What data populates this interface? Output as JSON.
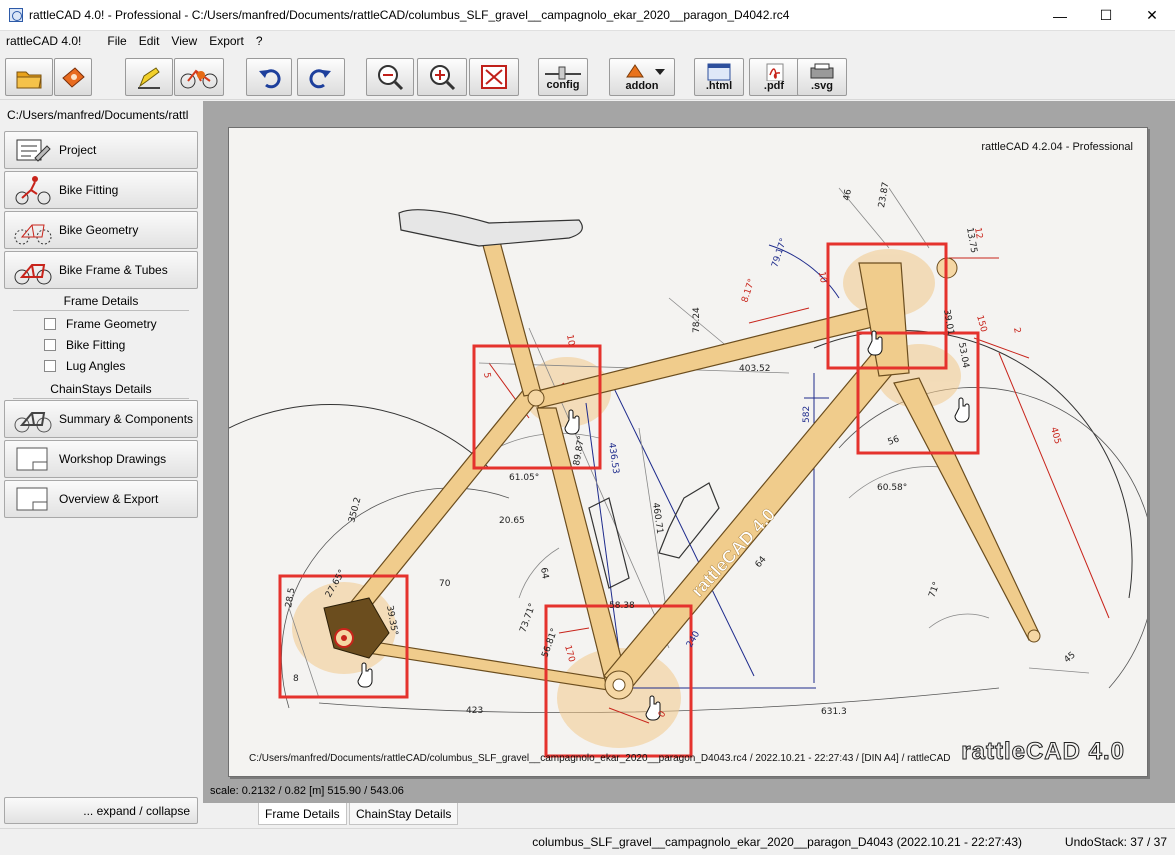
{
  "window": {
    "title": "rattleCAD 4.0! - Professional  - C:/Users/manfred/Documents/rattleCAD/columbus_SLF_gravel__campagnolo_ekar_2020__paragon_D4042.rc4",
    "minimize": "—",
    "maximize": "☐",
    "close": "✕"
  },
  "menu": {
    "app": "rattleCAD 4.0!",
    "items": [
      "File",
      "Edit",
      "View",
      "Export",
      "?"
    ]
  },
  "toolbar": {
    "buttons": [
      {
        "icon": "open-folder-icon"
      },
      {
        "icon": "template-icon"
      },
      {
        "icon": "edit-pen-icon"
      },
      {
        "icon": "bike-render-icon"
      },
      {
        "icon": "undo-icon"
      },
      {
        "icon": "redo-icon"
      },
      {
        "icon": "zoom-out-icon"
      },
      {
        "icon": "zoom-in-icon"
      },
      {
        "icon": "fit-to-window-icon"
      },
      {
        "icon": "config-icon",
        "label": "config"
      },
      {
        "icon": "addon-icon",
        "label": "addon"
      },
      {
        "icon": "html-export-icon",
        "label": ".html"
      },
      {
        "icon": "pdf-export-icon",
        "label": ".pdf"
      },
      {
        "icon": "svg-export-icon",
        "label": ".svg"
      }
    ]
  },
  "sidebar": {
    "path": "C:/Users/manfred/Documents/rattl",
    "nav": [
      {
        "label": "Project"
      },
      {
        "label": "Bike Fitting"
      },
      {
        "label": "Bike Geometry"
      },
      {
        "label": "Bike Frame & Tubes"
      }
    ],
    "frame_details": {
      "heading": "Frame Details",
      "items": [
        "Frame Geometry",
        "Bike Fitting",
        "Lug Angles"
      ]
    },
    "chainstays_heading": "ChainStays Details",
    "nav2": [
      {
        "label": "Summary & Components"
      },
      {
        "label": "Workshop Drawings"
      },
      {
        "label": "Overview & Export"
      }
    ],
    "expand_collapse": "... expand / collapse"
  },
  "drawing": {
    "header": "rattleCAD  4.2.04  -  Professional",
    "footer": "C:/Users/manfred/Documents/rattleCAD/columbus_SLF_gravel__campagnolo_ekar_2020__paragon_D4043.rc4   /   2022.10.21 - 22:27:43   /  [DIN A4]  /   rattleCAD",
    "logo": "rattleCAD 4.0",
    "downtube_brand": "rattleCAD 4.0",
    "dims": {
      "d350": "350.2",
      "d403": "403.52",
      "d582": "582",
      "d405": "405",
      "d631": "631.3",
      "d423": "423",
      "d436": "436.53",
      "d460": "460.71",
      "d79": "79.17°",
      "d817": "8.17°",
      "d6105": "61.05°",
      "d6058": "60.58°",
      "d7371": "73.71°",
      "d8987": "89.87°",
      "d71": "71°",
      "d170": "170",
      "d240": "240",
      "d64a": "64",
      "d64b": "64",
      "d2065": "20.65",
      "d70": "70",
      "d45": "45",
      "d56": "56",
      "d150": "150",
      "d46": "46",
      "d2387": "23.87",
      "d1375": "13.75",
      "d12": "12",
      "d10a": "10",
      "d10b": "10",
      "d5": "5",
      "d8": "8",
      "d2": "2",
      "d7824": "78.24",
      "d3901": "39.01",
      "d5304": "53.04",
      "d0": "0",
      "d285": "28.5",
      "d3935": "39.35°",
      "d2765": "27.65°",
      "d5681": "56.81°",
      "d5838": "58.38"
    }
  },
  "canvas": {
    "scale_text": "scale: 0.2132 / 0.82  [m]  515.90 / 543.06"
  },
  "tabs": [
    "Frame Details",
    "ChainStay Details"
  ],
  "status": {
    "file": "columbus_SLF_gravel__campagnolo_ekar_2020__paragon_D4043 (2022.10.21 - 22:27:43)",
    "undo": "UndoStack: 37 / 37"
  },
  "colors": {
    "tube": "#f0cc8c",
    "tube_stroke": "#6b4d1e",
    "highlight": "#e5322d",
    "dimension": "#1e2b8c",
    "sheet": "#f4f3f1",
    "canvas_bg": "#a5a5a5"
  }
}
